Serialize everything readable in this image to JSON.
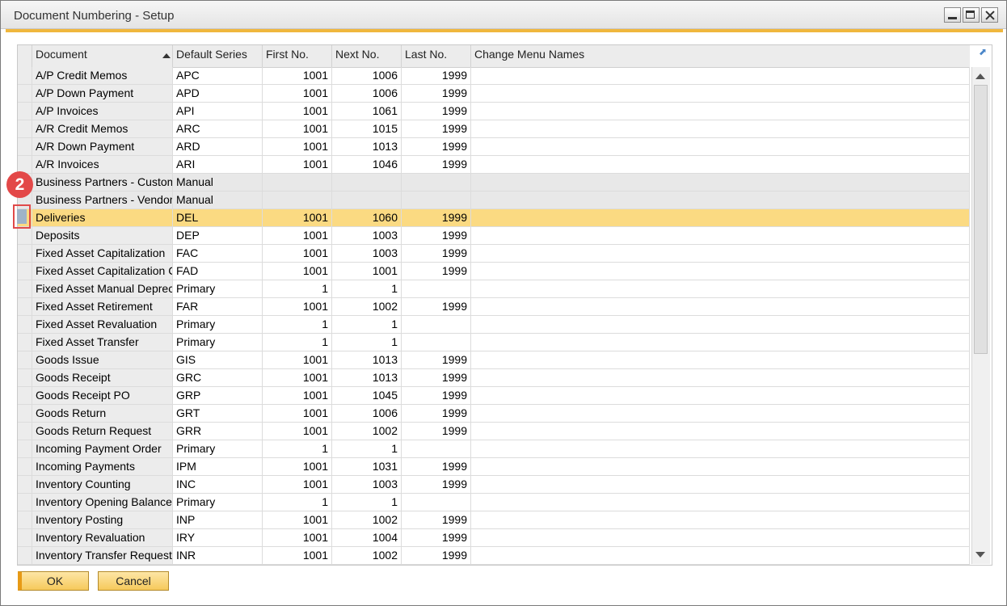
{
  "window": {
    "title": "Document Numbering - Setup"
  },
  "columns": [
    "Document",
    "Default Series",
    "First No.",
    "Next No.",
    "Last No.",
    "Change Menu Names"
  ],
  "rows": [
    {
      "doc": "A/P Credit Memos",
      "series": "APC",
      "first": "1001",
      "next": "1006",
      "last": "1999"
    },
    {
      "doc": "A/P Down Payment",
      "series": "APD",
      "first": "1001",
      "next": "1006",
      "last": "1999"
    },
    {
      "doc": "A/P Invoices",
      "series": "API",
      "first": "1001",
      "next": "1061",
      "last": "1999"
    },
    {
      "doc": "A/R Credit Memos",
      "series": "ARC",
      "first": "1001",
      "next": "1015",
      "last": "1999"
    },
    {
      "doc": "A/R Down Payment",
      "series": "ARD",
      "first": "1001",
      "next": "1013",
      "last": "1999"
    },
    {
      "doc": "A/R Invoices",
      "series": "ARI",
      "first": "1001",
      "next": "1046",
      "last": "1999"
    },
    {
      "doc": "Business Partners - Customer",
      "series": "Manual",
      "first": "",
      "next": "",
      "last": "",
      "grey": true
    },
    {
      "doc": "Business Partners - Vendor",
      "series": "Manual",
      "first": "",
      "next": "",
      "last": "",
      "grey": true
    },
    {
      "doc": "Deliveries",
      "series": "DEL",
      "first": "1001",
      "next": "1060",
      "last": "1999",
      "selected": true
    },
    {
      "doc": "Deposits",
      "series": "DEP",
      "first": "1001",
      "next": "1003",
      "last": "1999"
    },
    {
      "doc": "Fixed Asset Capitalization",
      "series": "FAC",
      "first": "1001",
      "next": "1003",
      "last": "1999"
    },
    {
      "doc": "Fixed Asset Capitalization Credit",
      "series": "FAD",
      "first": "1001",
      "next": "1001",
      "last": "1999"
    },
    {
      "doc": "Fixed Asset Manual Depreciation",
      "series": "Primary",
      "first": "1",
      "next": "1",
      "last": ""
    },
    {
      "doc": "Fixed Asset Retirement",
      "series": "FAR",
      "first": "1001",
      "next": "1002",
      "last": "1999"
    },
    {
      "doc": "Fixed Asset Revaluation",
      "series": "Primary",
      "first": "1",
      "next": "1",
      "last": ""
    },
    {
      "doc": "Fixed Asset Transfer",
      "series": "Primary",
      "first": "1",
      "next": "1",
      "last": ""
    },
    {
      "doc": "Goods Issue",
      "series": "GIS",
      "first": "1001",
      "next": "1013",
      "last": "1999"
    },
    {
      "doc": "Goods Receipt",
      "series": "GRC",
      "first": "1001",
      "next": "1013",
      "last": "1999"
    },
    {
      "doc": "Goods Receipt PO",
      "series": "GRP",
      "first": "1001",
      "next": "1045",
      "last": "1999"
    },
    {
      "doc": "Goods Return",
      "series": "GRT",
      "first": "1001",
      "next": "1006",
      "last": "1999"
    },
    {
      "doc": "Goods Return Request",
      "series": "GRR",
      "first": "1001",
      "next": "1002",
      "last": "1999"
    },
    {
      "doc": "Incoming Payment Order",
      "series": "Primary",
      "first": "1",
      "next": "1",
      "last": ""
    },
    {
      "doc": "Incoming Payments",
      "series": "IPM",
      "first": "1001",
      "next": "1031",
      "last": "1999"
    },
    {
      "doc": "Inventory Counting",
      "series": "INC",
      "first": "1001",
      "next": "1003",
      "last": "1999"
    },
    {
      "doc": "Inventory Opening Balances",
      "series": "Primary",
      "first": "1",
      "next": "1",
      "last": ""
    },
    {
      "doc": "Inventory Posting",
      "series": "INP",
      "first": "1001",
      "next": "1002",
      "last": "1999"
    },
    {
      "doc": "Inventory Revaluation",
      "series": "IRY",
      "first": "1001",
      "next": "1004",
      "last": "1999"
    },
    {
      "doc": "Inventory Transfer Request",
      "series": "INR",
      "first": "1001",
      "next": "1002",
      "last": "1999"
    }
  ],
  "callout": "2",
  "buttons": {
    "ok": "OK",
    "cancel": "Cancel"
  },
  "icons": {
    "expand": "expand-icon",
    "sort": "sort-ascending-icon"
  }
}
